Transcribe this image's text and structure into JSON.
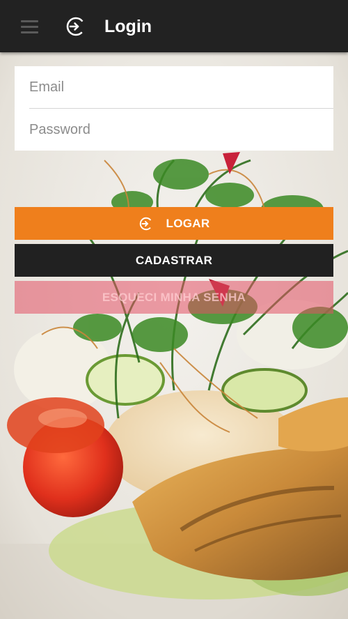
{
  "app_bar": {
    "title": "Login",
    "menu_icon": "hamburger-menu-icon",
    "title_icon": "login-icon"
  },
  "form": {
    "email_placeholder": "Email",
    "email_value": "",
    "password_placeholder": "Password",
    "password_value": ""
  },
  "buttons": {
    "login_label": "LOGAR",
    "login_icon": "login-icon",
    "register_label": "CADASTRAR",
    "forgot_label": "ESQUECI MINHA SENHA"
  },
  "colors": {
    "app_bar": "#222222",
    "login_button": "#ef7f1c",
    "register_button": "#212121",
    "forgot_button": "#e25064"
  }
}
